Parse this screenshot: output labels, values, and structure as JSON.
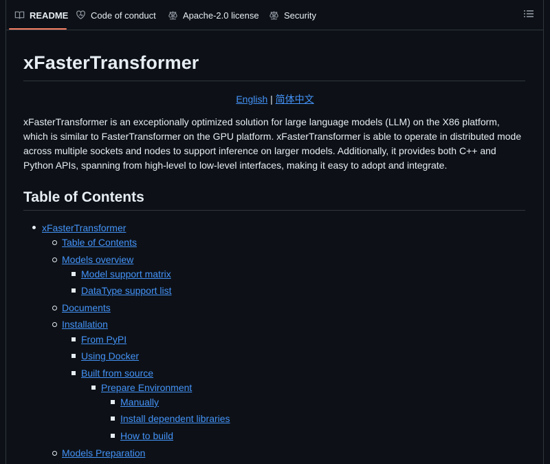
{
  "tabs": [
    {
      "label": "README",
      "icon": "book-icon",
      "active": true
    },
    {
      "label": "Code of conduct",
      "icon": "heart-icon",
      "active": false
    },
    {
      "label": "Apache-2.0 license",
      "icon": "law-icon",
      "active": false
    },
    {
      "label": "Security",
      "icon": "law-icon",
      "active": false
    }
  ],
  "readme": {
    "title": "xFasterTransformer",
    "lang_english": "English",
    "lang_sep": "|",
    "lang_chinese": "简体中文",
    "intro": "xFasterTransformer is an exceptionally optimized solution for large language models (LLM) on the X86 platform, which is similar to FasterTransformer on the GPU platform. xFasterTransformer is able to operate in distributed mode across multiple sockets and nodes to support inference on larger models. Additionally, it provides both C++ and Python APIs, spanning from high-level to low-level interfaces, making it easy to adopt and integrate.",
    "toc_heading": "Table of Contents",
    "toc": [
      {
        "label": "xFasterTransformer",
        "level": 1
      },
      {
        "label": "Table of Contents",
        "level": 2
      },
      {
        "label": "Models overview",
        "level": 2
      },
      {
        "label": "Model support matrix",
        "level": 3
      },
      {
        "label": "DataType support list",
        "level": 3
      },
      {
        "label": "Documents",
        "level": 2
      },
      {
        "label": "Installation",
        "level": 2
      },
      {
        "label": "From PyPI",
        "level": 3
      },
      {
        "label": "Using Docker",
        "level": 3
      },
      {
        "label": "Built from source",
        "level": 3
      },
      {
        "label": "Prepare Environment",
        "level": 4
      },
      {
        "label": "Manually",
        "level": 5
      },
      {
        "label": "Install dependent libraries",
        "level": 5
      },
      {
        "label": "How to build",
        "level": 5
      },
      {
        "label": "Models Preparation",
        "level": 2
      }
    ]
  },
  "colors": {
    "background": "#0d1117",
    "text": "#e6edf3",
    "link": "#4493f8",
    "border": "#30363d",
    "active_tab_underline": "#f78166"
  }
}
